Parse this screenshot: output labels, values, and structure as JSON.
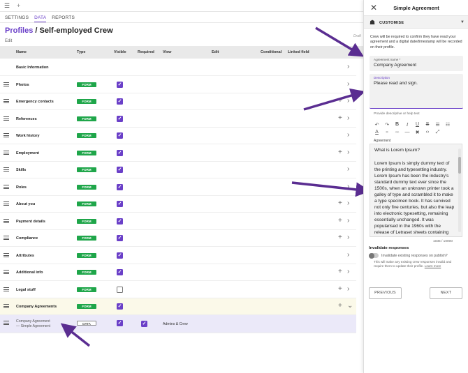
{
  "topbar": {
    "menu_icon": "hamburger-icon",
    "add_icon": "plus-icon"
  },
  "tabs": [
    {
      "label": "SETTINGS",
      "active": false
    },
    {
      "label": "DATA",
      "active": true
    },
    {
      "label": "REPORTS",
      "active": false
    }
  ],
  "header": {
    "crumb": "Profiles",
    "sep": "/",
    "title": "Self-employed Crew",
    "edit": "Edit",
    "status": "Draft"
  },
  "table": {
    "columns": [
      "Name",
      "Type",
      "Visible",
      "Required",
      "View",
      "Edit",
      "Conditional",
      "Linked field"
    ],
    "rows": [
      {
        "name": "Basic Information"
      },
      {
        "name": "Photos",
        "type": "FORM",
        "visible": true
      },
      {
        "name": "Emergency contacts",
        "type": "FORM",
        "visible": true
      },
      {
        "name": "References",
        "type": "FORM",
        "visible": true
      },
      {
        "name": "Work history",
        "type": "FORM",
        "visible": true
      },
      {
        "name": "Employment",
        "type": "FORM",
        "visible": true
      },
      {
        "name": "Skills",
        "type": "FORM",
        "visible": true
      },
      {
        "name": "Roles",
        "type": "FORM",
        "visible": true
      },
      {
        "name": "About you",
        "type": "FORM",
        "visible": true
      },
      {
        "name": "Payment details",
        "type": "FORM",
        "visible": true
      },
      {
        "name": "Compliance",
        "type": "FORM",
        "visible": true
      },
      {
        "name": "Attributes",
        "type": "FORM",
        "visible": true
      },
      {
        "name": "Additional info",
        "type": "FORM",
        "visible": true
      },
      {
        "name": "Legal stuff",
        "type": "FORM",
        "visible": false
      },
      {
        "name": "Company Agreements",
        "type": "FORM",
        "visible": true
      }
    ],
    "sub_row": {
      "name": "Company Agreement",
      "sub": "— Simple Agreement",
      "type": "DATA",
      "visible": true,
      "required": true,
      "view": "Admins & Crew"
    }
  },
  "panel": {
    "title": "Simple Agreement",
    "customise": "CUSTOMISE",
    "info": "Crew will be required to confirm they have read your agreement and a digital date/timestamp will be recorded on their profile.",
    "name_label": "Agreement name *",
    "name_value": "Company Agreement",
    "desc_label": "Description",
    "desc_value": "Please read and sign.",
    "help": "Provide descriptive or help text",
    "agreement_label": "Agreement",
    "editor_heading": "What is Lorem Ipsum?",
    "editor_body": "Lorem Ipsum is simply dummy text of the printing and typesetting industry. Lorem Ipsum has been the industry's standard dummy text ever since the 1500s, when an unknown printer took a galley of type and scrambled it to make a type specimen book. It has survived not only five centuries, but also the leap into electronic typesetting, remaining essentially unchanged. It was popularised in the 1960s with the release of Letraset sheets containing Lorem Ipsum",
    "char_count": "1035 / 10000",
    "invalidate_heading": "Invalidate responses",
    "invalidate_label": "Invalidate existing responses on publish?",
    "invalidate_note": "This will make any existing crew responses invalid and require them to update their profile.",
    "learn_more": "Learn more",
    "prev": "PREVIOUS",
    "next": "NEXT"
  },
  "colors": {
    "accent": "#6a3fc8",
    "form_badge": "#1fa64a",
    "highlight_row": "#fbf9e9",
    "sub_row": "#ebe9f9"
  }
}
